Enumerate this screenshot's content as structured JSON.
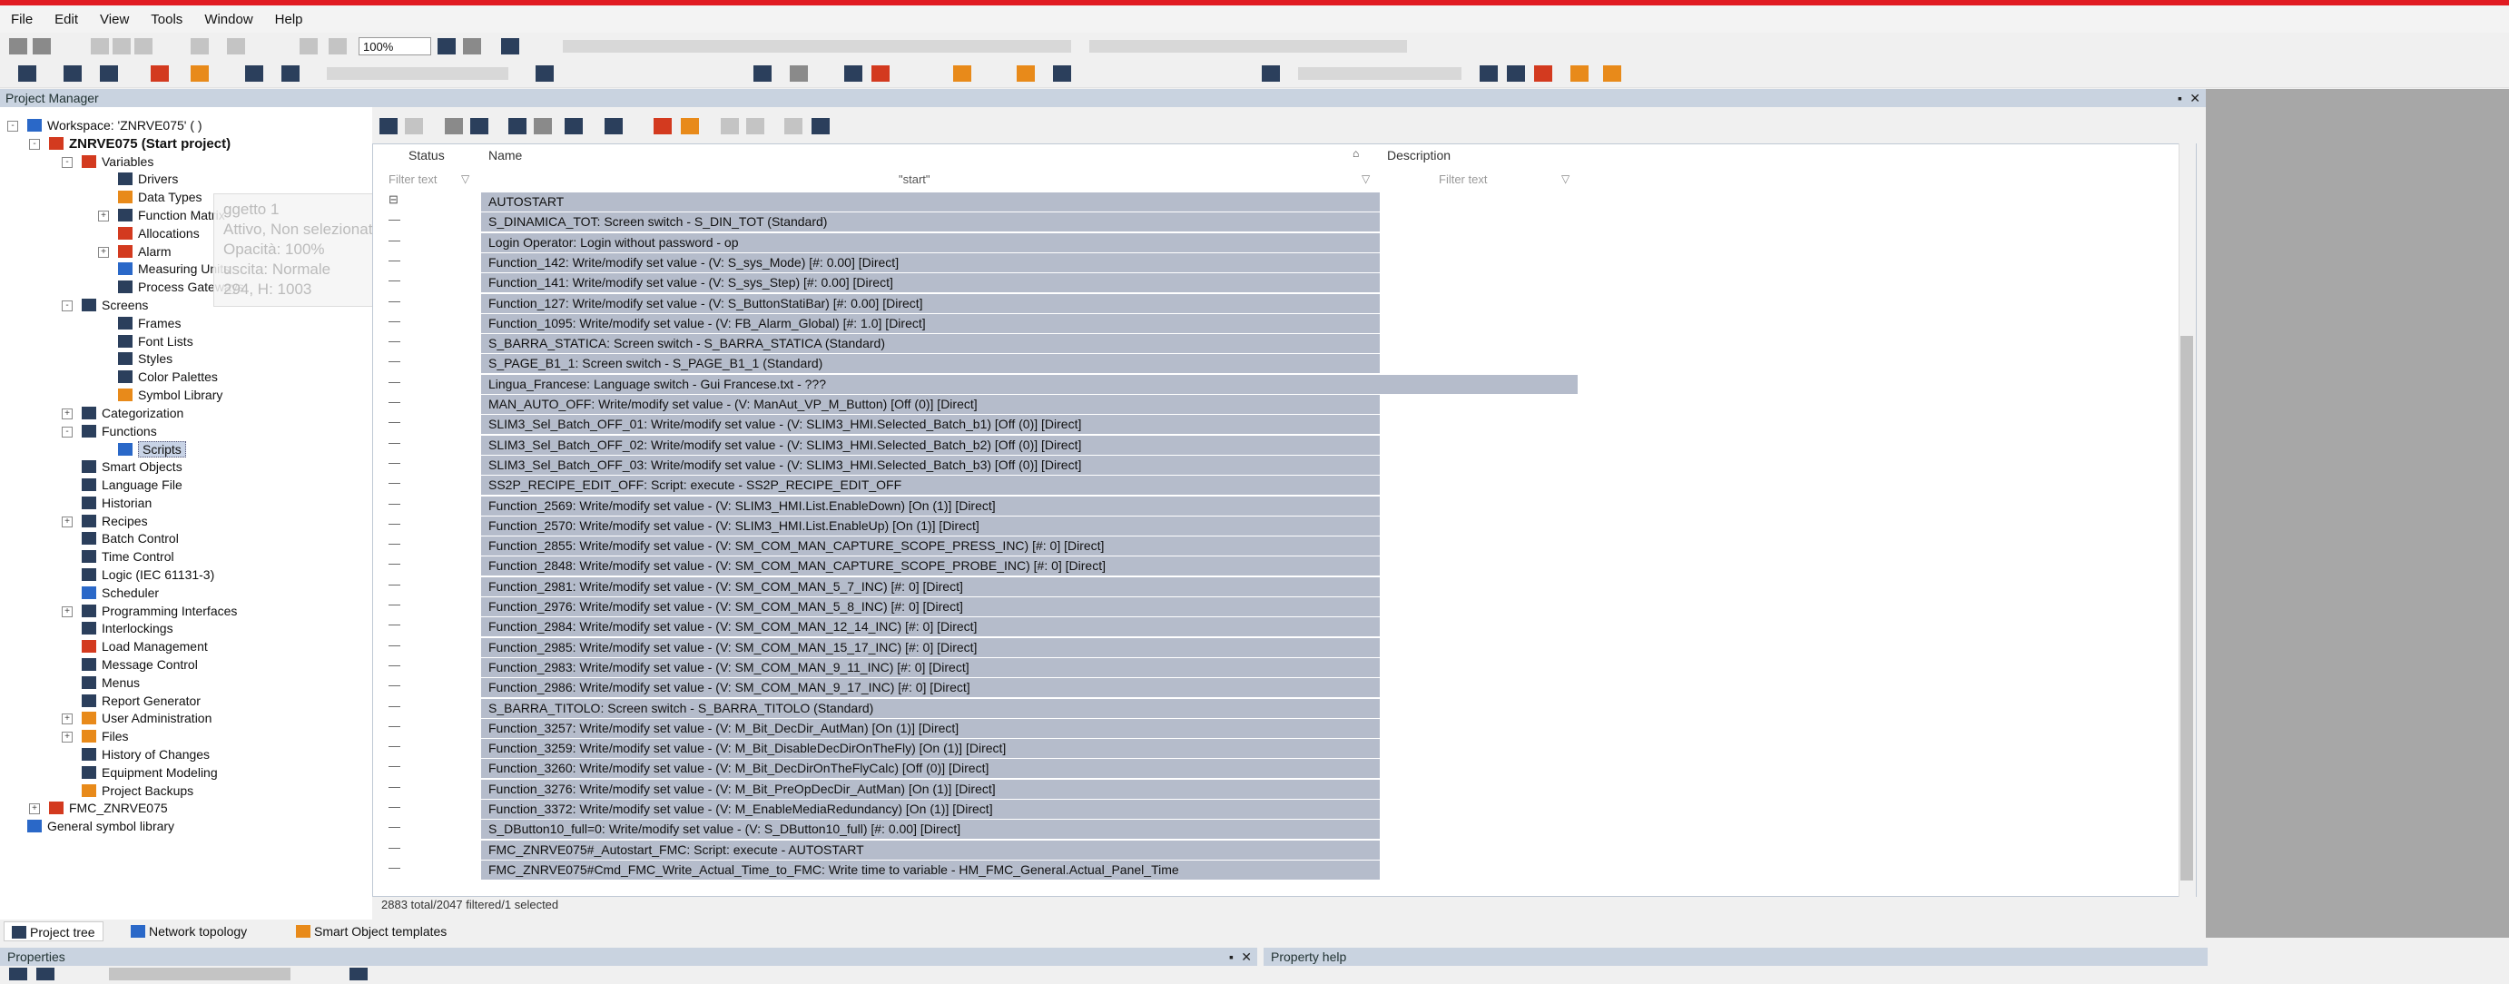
{
  "menu": [
    "File",
    "Edit",
    "View",
    "Tools",
    "Window",
    "Help"
  ],
  "toolbar": {
    "zoom": "100%"
  },
  "project_manager": {
    "title": "Project Manager"
  },
  "tree": [
    {
      "label": "Workspace: 'ZNRVE075' ( )",
      "level": 0,
      "bold": false,
      "icon": "workspace-icon",
      "color": "#2a68c8",
      "exp": "-"
    },
    {
      "label": "ZNRVE075 (Start project)",
      "level": 1,
      "bold": true,
      "icon": "project-icon",
      "color": "#d33a1f",
      "exp": "-"
    },
    {
      "label": "Variables",
      "level": 2,
      "bold": false,
      "icon": "variables-icon",
      "color": "#d33a1f",
      "exp": "-"
    },
    {
      "label": "Drivers",
      "level": 3,
      "bold": false,
      "icon": "drivers-icon",
      "color": "#2b3f5c",
      "exp": ""
    },
    {
      "label": "Data Types",
      "level": 3,
      "bold": false,
      "icon": "data-types-icon",
      "color": "#e88a1a",
      "exp": ""
    },
    {
      "label": "Function Matrix",
      "level": 3,
      "bold": false,
      "icon": "function-matrix-icon",
      "color": "#2b3f5c",
      "exp": "+"
    },
    {
      "label": "Allocations",
      "level": 3,
      "bold": false,
      "icon": "allocations-icon",
      "color": "#d33a1f",
      "exp": ""
    },
    {
      "label": "Alarm",
      "level": 3,
      "bold": false,
      "icon": "alarm-icon",
      "color": "#d33a1f",
      "exp": "+"
    },
    {
      "label": "Measuring Units",
      "level": 3,
      "bold": false,
      "icon": "measuring-units-icon",
      "color": "#2a68c8",
      "exp": ""
    },
    {
      "label": "Process Gateways",
      "level": 3,
      "bold": false,
      "icon": "process-gateways-icon",
      "color": "#2b3f5c",
      "exp": ""
    },
    {
      "label": "Screens",
      "level": 2,
      "bold": false,
      "icon": "screens-icon",
      "color": "#2b3f5c",
      "exp": "-"
    },
    {
      "label": "Frames",
      "level": 3,
      "bold": false,
      "icon": "frames-icon",
      "color": "#2b3f5c",
      "exp": ""
    },
    {
      "label": "Font Lists",
      "level": 3,
      "bold": false,
      "icon": "font-lists-icon",
      "color": "#2b3f5c",
      "exp": ""
    },
    {
      "label": "Styles",
      "level": 3,
      "bold": false,
      "icon": "styles-icon",
      "color": "#2b3f5c",
      "exp": ""
    },
    {
      "label": "Color Palettes",
      "level": 3,
      "bold": false,
      "icon": "color-palettes-icon",
      "color": "#2b3f5c",
      "exp": ""
    },
    {
      "label": "Symbol Library",
      "level": 3,
      "bold": false,
      "icon": "symbol-library-icon",
      "color": "#e88a1a",
      "exp": ""
    },
    {
      "label": "Categorization",
      "level": 2,
      "bold": false,
      "icon": "categorization-icon",
      "color": "#2b3f5c",
      "exp": "+"
    },
    {
      "label": "Functions",
      "level": 2,
      "bold": false,
      "icon": "functions-icon",
      "color": "#2b3f5c",
      "exp": "-"
    },
    {
      "label": "Scripts",
      "level": 3,
      "bold": false,
      "icon": "scripts-icon",
      "color": "#2a68c8",
      "exp": "",
      "selected": true
    },
    {
      "label": "Smart Objects",
      "level": 2,
      "bold": false,
      "icon": "smart-objects-icon",
      "color": "#2b3f5c",
      "exp": ""
    },
    {
      "label": "Language File",
      "level": 2,
      "bold": false,
      "icon": "language-file-icon",
      "color": "#2b3f5c",
      "exp": ""
    },
    {
      "label": "Historian",
      "level": 2,
      "bold": false,
      "icon": "historian-icon",
      "color": "#2b3f5c",
      "exp": ""
    },
    {
      "label": "Recipes",
      "level": 2,
      "bold": false,
      "icon": "recipes-icon",
      "color": "#2b3f5c",
      "exp": "+"
    },
    {
      "label": "Batch Control",
      "level": 2,
      "bold": false,
      "icon": "batch-control-icon",
      "color": "#2b3f5c",
      "exp": ""
    },
    {
      "label": "Time Control",
      "level": 2,
      "bold": false,
      "icon": "time-control-icon",
      "color": "#2b3f5c",
      "exp": ""
    },
    {
      "label": "Logic (IEC 61131-3)",
      "level": 2,
      "bold": false,
      "icon": "logic-icon",
      "color": "#2b3f5c",
      "exp": ""
    },
    {
      "label": "Scheduler",
      "level": 2,
      "bold": false,
      "icon": "scheduler-icon",
      "color": "#2a68c8",
      "exp": ""
    },
    {
      "label": "Programming Interfaces",
      "level": 2,
      "bold": false,
      "icon": "programming-interfaces-icon",
      "color": "#2b3f5c",
      "exp": "+"
    },
    {
      "label": "Interlockings",
      "level": 2,
      "bold": false,
      "icon": "interlockings-icon",
      "color": "#2b3f5c",
      "exp": ""
    },
    {
      "label": "Load Management",
      "level": 2,
      "bold": false,
      "icon": "load-management-icon",
      "color": "#d33a1f",
      "exp": ""
    },
    {
      "label": "Message Control",
      "level": 2,
      "bold": false,
      "icon": "message-control-icon",
      "color": "#2b3f5c",
      "exp": ""
    },
    {
      "label": "Menus",
      "level": 2,
      "bold": false,
      "icon": "menus-icon",
      "color": "#2b3f5c",
      "exp": ""
    },
    {
      "label": "Report Generator",
      "level": 2,
      "bold": false,
      "icon": "report-generator-icon",
      "color": "#2b3f5c",
      "exp": ""
    },
    {
      "label": "User Administration",
      "level": 2,
      "bold": false,
      "icon": "user-administration-icon",
      "color": "#e88a1a",
      "exp": "+"
    },
    {
      "label": "Files",
      "level": 2,
      "bold": false,
      "icon": "files-icon",
      "color": "#e88a1a",
      "exp": "+"
    },
    {
      "label": "History of Changes",
      "level": 2,
      "bold": false,
      "icon": "history-of-changes-icon",
      "color": "#2b3f5c",
      "exp": ""
    },
    {
      "label": "Equipment Modeling",
      "level": 2,
      "bold": false,
      "icon": "equipment-modeling-icon",
      "color": "#2b3f5c",
      "exp": ""
    },
    {
      "label": "Project Backups",
      "level": 2,
      "bold": false,
      "icon": "project-backups-icon",
      "color": "#e88a1a",
      "exp": ""
    },
    {
      "label": "FMC_ZNRVE075",
      "level": 1,
      "bold": false,
      "icon": "fmc-project-icon",
      "color": "#d33a1f",
      "exp": "+"
    },
    {
      "label": "General symbol library",
      "level": 0,
      "bold": false,
      "icon": "general-symbol-library-icon",
      "color": "#2a68c8",
      "exp": ""
    }
  ],
  "tooltip": [
    "ggetto 1",
    "Attivo, Non selezionato",
    "Opacità: 100%",
    "uscita: Normale",
    "294, H: 1003"
  ],
  "grid": {
    "headers": {
      "status": "Status",
      "name": "Name",
      "description": "Description"
    },
    "filters": {
      "status": "Filter text",
      "name": "\"start\"",
      "description": "Filter text"
    },
    "rows": [
      "AUTOSTART",
      "S_DINAMICA_TOT: Screen switch - S_DIN_TOT (Standard)",
      "Login Operator: Login without password - op",
      "Function_142: Write/modify set value - (V: S_sys_Mode) [#: 0.00] [Direct]",
      "Function_141: Write/modify set value - (V: S_sys_Step) [#: 0.00] [Direct]",
      "Function_127: Write/modify set value - (V: S_ButtonStatiBar) [#: 0.00] [Direct]",
      "Function_1095: Write/modify set value - (V: FB_Alarm_Global) [#: 1.0] [Direct]",
      "S_BARRA_STATICA: Screen switch - S_BARRA_STATICA (Standard)",
      "S_PAGE_B1_1: Screen switch - S_PAGE_B1_1 (Standard)",
      "Lingua_Francese: Language switch - Gui Francese.txt - ???",
      "MAN_AUTO_OFF: Write/modify set value - (V: ManAut_VP_M_Button) [Off (0)] [Direct]",
      "SLIM3_Sel_Batch_OFF_01: Write/modify set value - (V: SLIM3_HMI.Selected_Batch_b1) [Off (0)] [Direct]",
      "SLIM3_Sel_Batch_OFF_02: Write/modify set value - (V: SLIM3_HMI.Selected_Batch_b2) [Off (0)] [Direct]",
      "SLIM3_Sel_Batch_OFF_03: Write/modify set value - (V: SLIM3_HMI.Selected_Batch_b3) [Off (0)] [Direct]",
      "SS2P_RECIPE_EDIT_OFF: Script: execute - SS2P_RECIPE_EDIT_OFF",
      "Function_2569: Write/modify set value - (V: SLIM3_HMI.List.EnableDown) [On (1)] [Direct]",
      "Function_2570: Write/modify set value - (V: SLIM3_HMI.List.EnableUp) [On (1)] [Direct]",
      "Function_2855: Write/modify set value - (V: SM_COM_MAN_CAPTURE_SCOPE_PRESS_INC) [#: 0] [Direct]",
      "Function_2848: Write/modify set value - (V: SM_COM_MAN_CAPTURE_SCOPE_PROBE_INC) [#: 0] [Direct]",
      "Function_2981: Write/modify set value - (V: SM_COM_MAN_5_7_INC) [#: 0] [Direct]",
      "Function_2976: Write/modify set value - (V: SM_COM_MAN_5_8_INC) [#: 0] [Direct]",
      "Function_2984: Write/modify set value - (V: SM_COM_MAN_12_14_INC) [#: 0] [Direct]",
      "Function_2985: Write/modify set value - (V: SM_COM_MAN_15_17_INC) [#: 0] [Direct]",
      "Function_2983: Write/modify set value - (V: SM_COM_MAN_9_11_INC) [#: 0] [Direct]",
      "Function_2986: Write/modify set value - (V: SM_COM_MAN_9_17_INC) [#: 0] [Direct]",
      "S_BARRA_TITOLO: Screen switch - S_BARRA_TITOLO (Standard)",
      "Function_3257: Write/modify set value - (V: M_Bit_DecDir_AutMan) [On (1)] [Direct]",
      "Function_3259: Write/modify set value - (V: M_Bit_DisableDecDirOnTheFly) [On (1)] [Direct]",
      "Function_3260: Write/modify set value - (V: M_Bit_DecDirOnTheFlyCalc) [Off (0)] [Direct]",
      "Function_3276: Write/modify set value - (V: M_Bit_PreOpDecDir_AutMan) [On (1)] [Direct]",
      "Function_3372: Write/modify set value - (V: M_EnableMediaRedundancy) [On (1)] [Direct]",
      "S_DButton10_full=0: Write/modify set value - (V: S_DButton10_full) [#: 0.00] [Direct]",
      "FMC_ZNRVE075#_Autostart_FMC: Script: execute - AUTOSTART",
      "FMC_ZNRVE075#Cmd_FMC_Write_Actual_Time_to_FMC: Write time to variable - HM_FMC_General.Actual_Panel_Time"
    ],
    "selected_row": 9,
    "status": "2883 total/2047 filtered/1 selected"
  },
  "bottom_tabs": [
    "Project tree",
    "Network topology",
    "Smart Object templates"
  ],
  "panels": {
    "properties": "Properties",
    "property_help": "Property help"
  },
  "colors": {
    "accent_red": "#e11b22",
    "row_highlight": "#b5bccb",
    "title_bar": "#c9d3e0"
  }
}
